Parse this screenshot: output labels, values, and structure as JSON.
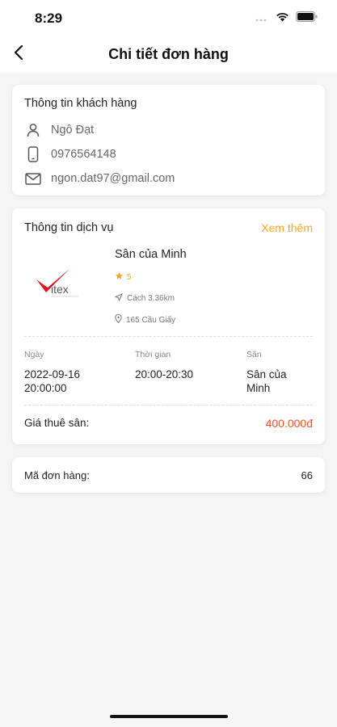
{
  "status_bar": {
    "time": "8:29"
  },
  "header": {
    "title": "Chi tiết đơn hàng"
  },
  "customer": {
    "title": "Thông tin khách hàng",
    "name": "Ngô Đạt",
    "phone": "0976564148",
    "email": "ngon.dat97@gmail.com"
  },
  "service": {
    "title": "Thông tin dịch vụ",
    "see_more": "Xem thêm",
    "venue_name": "Sân của Minh",
    "rating": "5",
    "distance": "Cách 3.36km",
    "address": "165 Cầu Giấy",
    "logo_text": "itex",
    "logo_tagline": "TIỆN ÍCH THỂ THAO",
    "date_label": "Ngày",
    "date_value": "2022-09-16 20:00:00",
    "time_label": "Thời gian",
    "time_value": "20:00-20:30",
    "court_label": "Sân",
    "court_value": "Sân của Minh",
    "price_label": "Giá thuê sân:",
    "price_value": "400.000đ"
  },
  "order": {
    "label": "Mã đơn hàng:",
    "value": "66"
  },
  "colors": {
    "accent": "#f5a623",
    "price": "#ff4b1f",
    "logo_red": "#d71920"
  }
}
